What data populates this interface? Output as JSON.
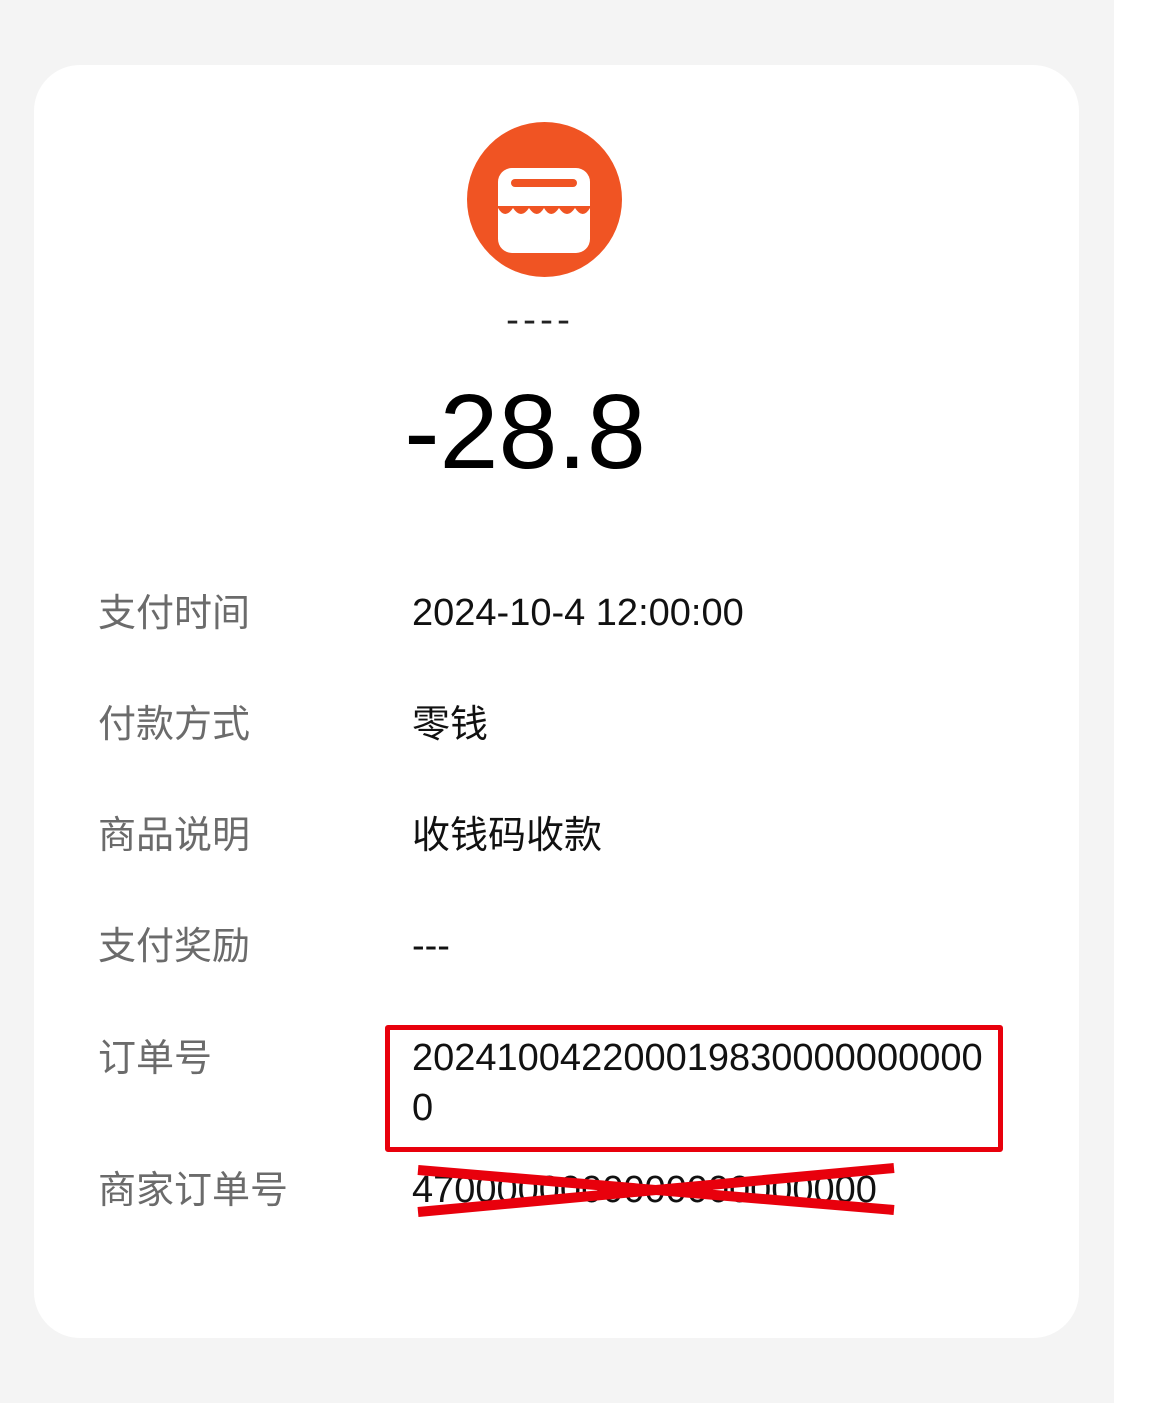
{
  "merchant": {
    "icon": "storefront-icon",
    "name": "----",
    "logo_color": "#f05423"
  },
  "amount": "-28.8",
  "details": {
    "payment_time": {
      "label": "支付时间",
      "value": "2024-10-4 12:00:00"
    },
    "payment_method": {
      "label": "付款方式",
      "value": "零钱"
    },
    "product_desc": {
      "label": "商品说明",
      "value": "收钱码收款"
    },
    "payment_reward": {
      "label": "支付奖励",
      "value": "---"
    },
    "order_no": {
      "label": "订单号",
      "value": "2024100422000198300000000000"
    },
    "merchant_order_no": {
      "label": "商家订单号",
      "value": "4700000000000000000000"
    }
  },
  "annotations": {
    "highlight_color": "#e8000c",
    "strike_color": "#e8000c"
  }
}
